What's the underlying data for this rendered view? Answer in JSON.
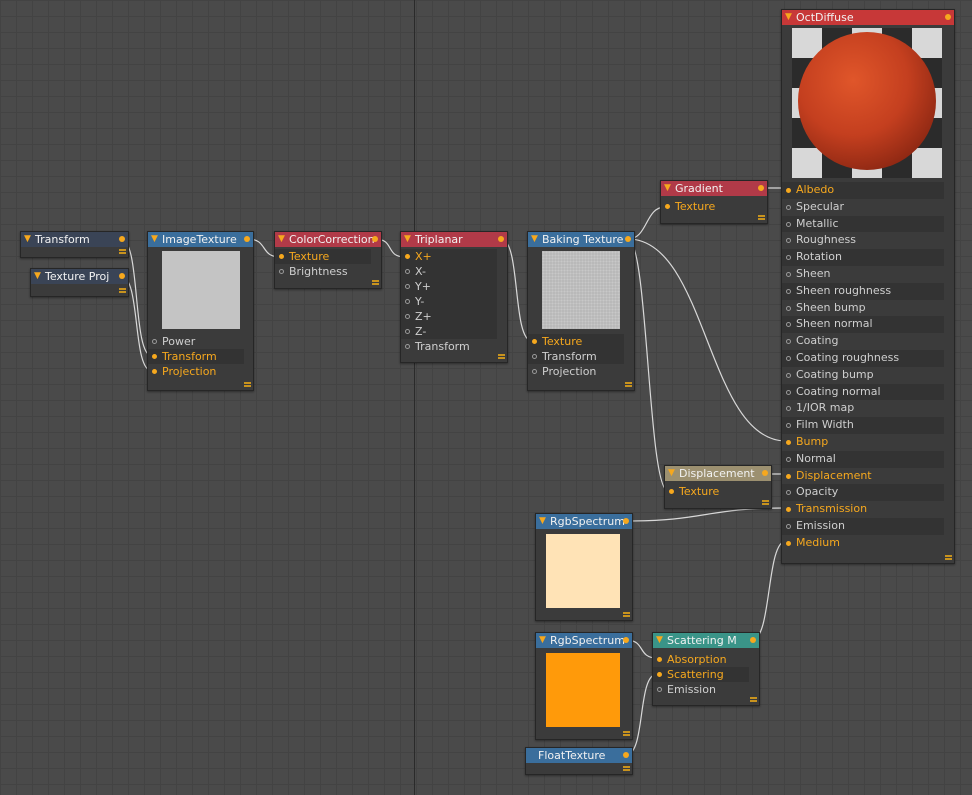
{
  "nodes": {
    "transform": {
      "title": "Transform"
    },
    "texture_proj": {
      "title": "Texture Proj"
    },
    "image_texture": {
      "title": "ImageTexture",
      "inputs": [
        "Power",
        "Transform",
        "Projection"
      ]
    },
    "color_correction": {
      "title": "ColorCorrection",
      "inputs": [
        "Texture",
        "Brightness"
      ]
    },
    "triplanar": {
      "title": "Triplanar",
      "inputs": [
        "X+",
        "X-",
        "Y+",
        "Y-",
        "Z+",
        "Z-",
        "Transform"
      ]
    },
    "baking_texture": {
      "title": "Baking Texture",
      "inputs": [
        "Texture",
        "Transform",
        "Projection"
      ]
    },
    "gradient": {
      "title": "Gradient",
      "inputs": [
        "Texture"
      ]
    },
    "displacement": {
      "title": "Displacement",
      "inputs": [
        "Texture"
      ]
    },
    "rgb_spectrum_1": {
      "title": "RgbSpectrum",
      "color": "#ffe3b6"
    },
    "rgb_spectrum_2": {
      "title": "RgbSpectrum",
      "color": "#ff9a0a"
    },
    "float_texture": {
      "title": "FloatTexture"
    },
    "scattering": {
      "title": "Scattering M",
      "inputs": [
        "Absorption",
        "Scattering",
        "Emission"
      ]
    },
    "oct_diffuse": {
      "title": "OctDiffuse",
      "inputs": [
        "Albedo",
        "Specular",
        "Metallic",
        "Roughness",
        "Rotation",
        "Sheen",
        "Sheen roughness",
        "Sheen bump",
        "Sheen normal",
        "Coating",
        "Coating roughness",
        "Coating bump",
        "Coating normal",
        "1/IOR map",
        "Film Width",
        "Bump",
        "Normal",
        "Displacement",
        "Opacity",
        "Transmission",
        "Emission",
        "Medium"
      ]
    }
  },
  "colors": {
    "accent": "#f6a81e",
    "canvas": "#4a4a4a",
    "wire": "#d8d8d8"
  }
}
